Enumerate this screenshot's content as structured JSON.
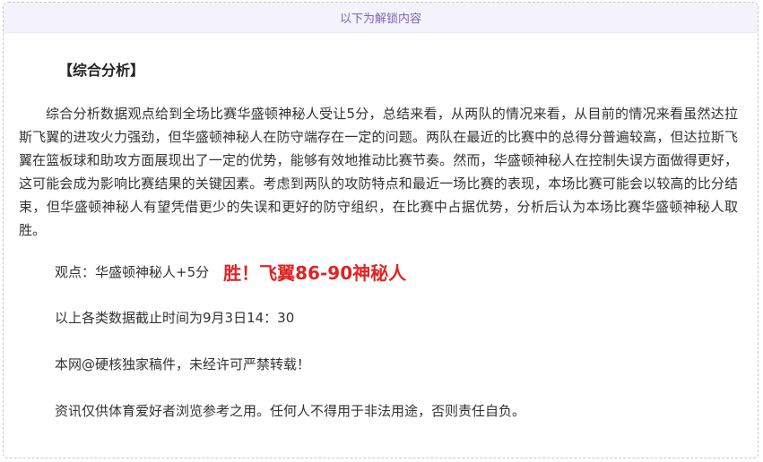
{
  "unlock_notice": "以下为解锁内容",
  "analysis": {
    "section_title": "【综合分析】",
    "paragraph": "综合分析数据观点给到全场比赛华盛顿神秘人受让5分，总结来看，从两队的情况来看，从目前的情况来看虽然达拉斯飞翼的进攻火力强劲，但华盛顿神秘人在防守端存在一定的问题。两队在最近的比赛中的总得分普遍较高，但达拉斯飞翼在篮板球和助攻方面展现出了一定的优势，能够有效地推动比赛节奏。然而，华盛顿神秘人在控制失误方面做得更好，这可能会成为影响比赛结果的关键因素。考虑到两队的攻防特点和最近一场比赛的表现，本场比赛可能会以较高的比分结束，但华盛顿神秘人有望凭借更少的失误和更好的防守组织，在比赛中占据优势，分析后认为本场比赛华盛顿神秘人取胜。"
  },
  "viewpoint": {
    "label": "观点：",
    "pick": "华盛顿神秘人+5分",
    "result": "胜！飞翼86-90神秘人"
  },
  "footer_lines": {
    "data_cutoff": "以上各类数据截止时间为9月3日14：30",
    "copyright": "本网@硬核独家稿件，未经许可严禁转载！",
    "disclaimer": "资讯仅供体育爱好者浏览参考之用。任何人不得用于非法用途，否则责任自负。"
  },
  "colors": {
    "result_red": "#e02424",
    "unlock_text": "#7a66b8",
    "unlock_bg": "#f4f2fb"
  }
}
